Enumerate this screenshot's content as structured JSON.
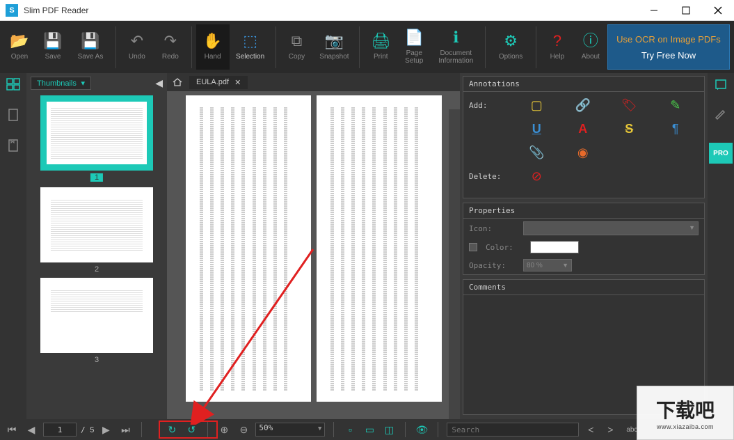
{
  "app": {
    "title": "Slim PDF Reader",
    "logo_letter": "S"
  },
  "toolbar": {
    "open": "Open",
    "save": "Save",
    "save_as": "Save As",
    "undo": "Undo",
    "redo": "Redo",
    "hand": "Hand",
    "selection": "Selection",
    "copy": "Copy",
    "snapshot": "Snapshot",
    "print": "Print",
    "page_setup": "Page\nSetup",
    "doc_info": "Document\nInformation",
    "options": "Options",
    "help": "Help",
    "about": "About"
  },
  "promo": {
    "line1": "Use OCR on Image PDFs",
    "line2": "Try Free Now"
  },
  "thumbnails": {
    "label": "Thumbnails",
    "items": [
      {
        "num": "1",
        "selected": true
      },
      {
        "num": "2",
        "selected": false
      },
      {
        "num": "3",
        "selected": false
      }
    ]
  },
  "document": {
    "tab_name": "EULA.pdf"
  },
  "annotations": {
    "title": "Annotations",
    "add_label": "Add:",
    "delete_label": "Delete:"
  },
  "properties": {
    "title": "Properties",
    "icon_label": "Icon:",
    "color_label": "Color:",
    "opacity_label": "Opacity:",
    "opacity_value": "80 %"
  },
  "comments": {
    "title": "Comments"
  },
  "pro_badge": "PRO",
  "bottombar": {
    "current_page": "1",
    "total_pages": "5",
    "zoom": "50%",
    "search_placeholder": "Search",
    "abc_label": "abc"
  },
  "watermark": {
    "big": "下载吧",
    "url": "www.xiazaiba.com"
  }
}
